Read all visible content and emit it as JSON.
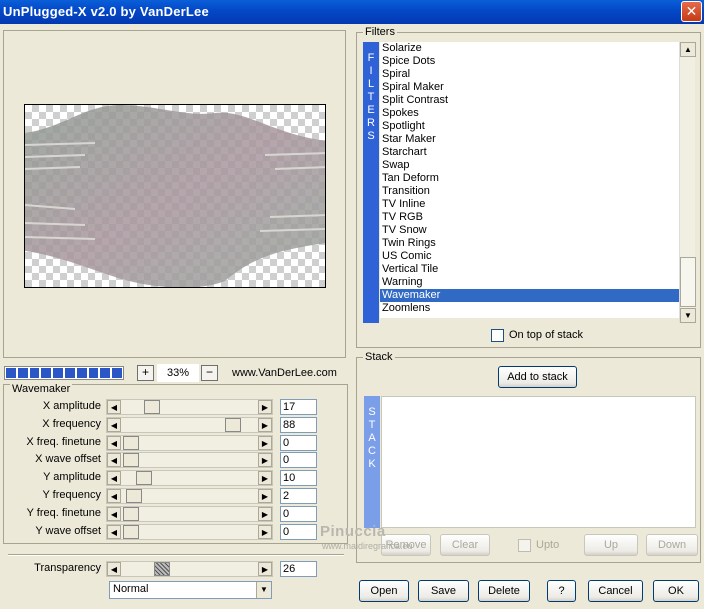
{
  "window": {
    "title": "UnPlugged-X v2.0 by VanDerLee",
    "close_label": "✕"
  },
  "toolbar": {
    "zoom_in_label": "+",
    "zoom_value": "33%",
    "zoom_out_label": "−",
    "website": "www.VanDerLee.com"
  },
  "wavemaker": {
    "title": "Wavemaker",
    "params": [
      {
        "label": "X amplitude",
        "value": "17"
      },
      {
        "label": "X frequency",
        "value": "88"
      },
      {
        "label": "X freq. finetune",
        "value": "0"
      },
      {
        "label": "X wave offset",
        "value": "0"
      },
      {
        "label": "Y amplitude",
        "value": "10"
      },
      {
        "label": "Y frequency",
        "value": "2"
      },
      {
        "label": "Y freq. finetune",
        "value": "0"
      },
      {
        "label": "Y wave offset",
        "value": "0"
      }
    ],
    "transparency": {
      "label": "Transparency",
      "value": "26"
    },
    "blend_mode": "Normal"
  },
  "filters": {
    "title": "Filters",
    "tab_letters": [
      "F",
      "I",
      "L",
      "T",
      "E",
      "R",
      "S"
    ],
    "items": [
      "Solarize",
      "Spice Dots",
      "Spiral",
      "Spiral Maker",
      "Split Contrast",
      "Spokes",
      "Spotlight",
      "Star Maker",
      "Starchart",
      "Swap",
      "Tan Deform",
      "Transition",
      "TV Inline",
      "TV RGB",
      "TV Snow",
      "Twin Rings",
      "US Comic",
      "Vertical Tile",
      "Warning",
      "Wavemaker",
      "Zoomlens"
    ],
    "selected": "Wavemaker",
    "on_top_label": "On top of stack"
  },
  "stack": {
    "title": "Stack",
    "tab_letters": [
      "S",
      "T",
      "A",
      "C",
      "K"
    ],
    "add_label": "Add to stack",
    "remove_label": "Remove",
    "clear_label": "Clear",
    "upto_label": "Upto",
    "up_label": "Up",
    "down_label": "Down"
  },
  "footer": {
    "open_label": "Open",
    "save_label": "Save",
    "delete_label": "Delete",
    "help_label": "?",
    "cancel_label": "Cancel",
    "ok_label": "OK"
  },
  "watermark": {
    "name": "Pinuccia",
    "site": "www.maidiregrafica.eu"
  },
  "colors": {
    "accent": "#316ac5",
    "titlebar": "#0449c9",
    "face": "#ece9d8"
  }
}
